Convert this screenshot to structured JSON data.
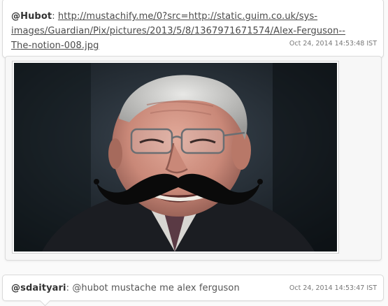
{
  "messages": [
    {
      "user": "@Hubot",
      "separator": ": ",
      "link_text": "http://mustachify.me/0?src=http://static.guim.co.uk/sys-images/Guardian/Pix/pictures/2013/5/8/1367971671574/Alex-Ferguson--The-notion-008.jpg",
      "timestamp": "Oct 24, 2014 14:53:48 IST",
      "image": {
        "alt": "Alex-Ferguson--The-notion-008.jpg"
      }
    },
    {
      "user": "@sdaityari",
      "separator": ": ",
      "text": "@hubot mustache me alex ferguson",
      "timestamp": "Oct 24, 2014 14:53:47 IST"
    }
  ],
  "colors": {
    "bubble_bg": "#ffffff",
    "border": "#d9d9d9",
    "text": "#555555"
  }
}
